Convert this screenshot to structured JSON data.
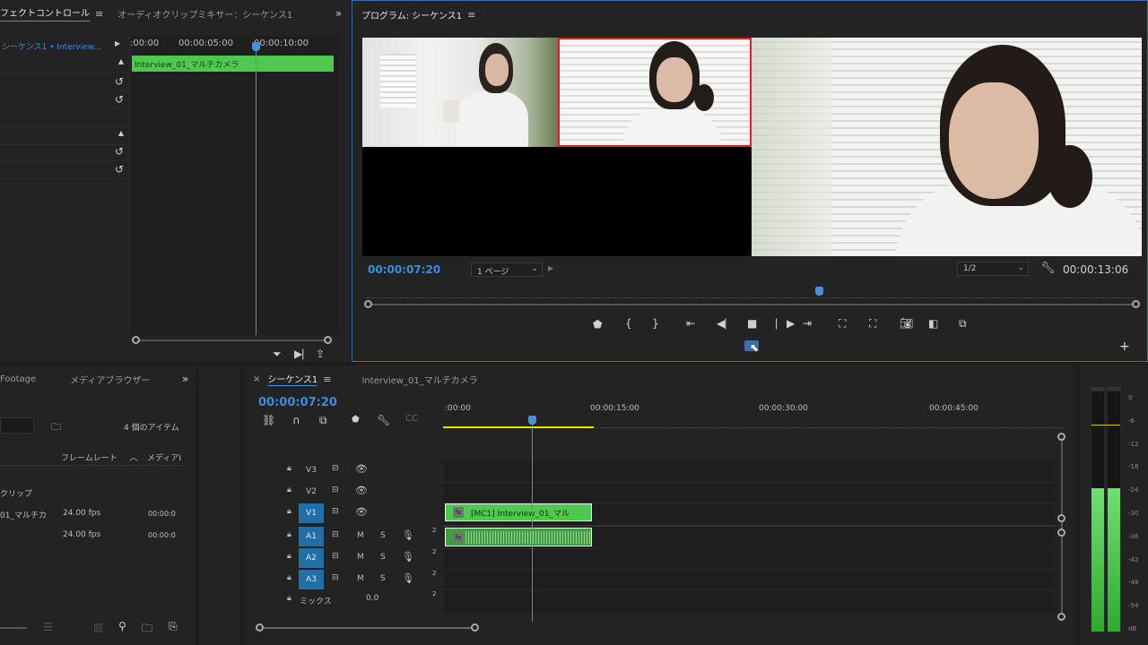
{
  "effect_controls": {
    "tab_label": "エフェクトコントロール",
    "tab2_label": "オーディオクリップミキサー：シーケンス1",
    "sequence_label": "シーケンス1 • Interview...",
    "ruler_ticks": [
      ":00:00",
      "00:00:05:00",
      "00:00:10:00"
    ],
    "clip_label": "Interview_01_マルチカメラ"
  },
  "program": {
    "title": "プログラム: シーケンス1",
    "timecode": "00:00:07:20",
    "page_select": "1 ページ",
    "resolution": "1/2",
    "duration": "00:00:13:06",
    "playhead_position": 0.59
  },
  "project": {
    "tab_label": "Footage",
    "tab2_label": "メディアブラウザー",
    "items_count": "4 個のアイテム",
    "col_framerate": "フレームレート",
    "col_media": "メディアI",
    "rows": [
      {
        "name": "クリップ",
        "fps": "",
        "time": ""
      },
      {
        "name": "01_マルチカ",
        "fps": "24.00 fps",
        "time": "00:00:0"
      },
      {
        "name": "",
        "fps": "24.00 fps",
        "time": "00:00:0"
      }
    ]
  },
  "timeline": {
    "tab_label": "シーケンス1",
    "tab2_label": "Interview_01_マルチカメラ",
    "timecode": "00:00:07:20",
    "ruler_ticks": [
      ":00:00",
      "00:00:15:00",
      "00:00:30:00",
      "00:00:45:00"
    ],
    "tracks": {
      "v3": "V3",
      "v2": "V2",
      "v1": "V1",
      "a1": "A1",
      "a2": "A2",
      "a3": "A3",
      "mix_label": "ミックス",
      "mix_value": "0.0",
      "m": "M",
      "s": "S",
      "ch": "2"
    },
    "video_clip": "[MC1] Interview_01_マル",
    "video_clip_fx": "fx"
  },
  "meter": {
    "labels": [
      "0",
      "-6",
      "-12",
      "-18",
      "-24",
      "-30",
      "-36",
      "-42",
      "-48",
      "-54",
      "dB"
    ],
    "left_level": 0.61,
    "right_level": 0.61
  },
  "colors": {
    "accent_blue": "#3d8be0",
    "clip_green": "#4fc84f",
    "record_red": "#e02020",
    "work_area_yellow": "#e6e600"
  }
}
